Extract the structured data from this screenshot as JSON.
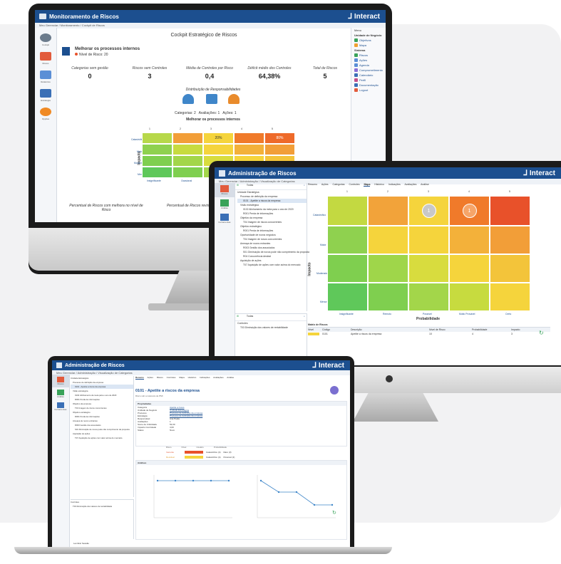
{
  "brand": "Interact",
  "colors": {
    "titlebar": "#1c4f8f",
    "heatmap_green": "#8fd14f",
    "heatmap_yellow": "#f5d43c",
    "heatmap_orange": "#f29e38",
    "heatmap_red": "#e8512a"
  },
  "cockpit": {
    "window_title": "Monitoramento de Riscos",
    "breadcrumb": "Meu Gerenciar  /  Monitoramento  /  Cockpit de Riscos",
    "page_title": "Cockpit Estratégico de Riscos",
    "objective_title": "Melhorar os processos internos",
    "risk_level": "Nível de Risco: 20",
    "sidebar": [
      "Cockpit",
      "Riscos",
      "Relatórios",
      "Estratégia",
      "Opções"
    ],
    "kpis": [
      {
        "label": "Categorias sem gestão",
        "value": "0"
      },
      {
        "label": "Riscos sem Controles",
        "value": "3"
      },
      {
        "label": "Média de Controles por Risco",
        "value": "0,4"
      },
      {
        "label": "Déficit médio dos Controles",
        "value": "64,38%"
      },
      {
        "label": "Total de Riscos",
        "value": "5"
      }
    ],
    "distribution_title": "Distribuição de Responsabilidades",
    "distribution_items": [
      "Categorias: 2",
      "Avaliações: 1",
      "Ações: 1"
    ],
    "matrix_title": "Melhorar os processos internos",
    "matrix_cols": [
      "1",
      "2",
      "3",
      "4",
      "5"
    ],
    "impact_axis": "Impacto",
    "impact_rows": [
      "Catastrófico",
      "Maior",
      "Moderado",
      "Menor"
    ],
    "prob_row": [
      "Insignificante",
      "Ocasional",
      "Possível",
      "Muito Provável",
      "Certo"
    ],
    "highlight_values": [
      "20%",
      "80%"
    ],
    "footer_left": "Percentual de Riscos com melhora no nível de Risco",
    "footer_mid": "Percentual de Riscos revisados",
    "right_panel": {
      "header": "Menu",
      "section1": "Unidade de Negócio",
      "items1": [
        "Objetivos",
        "Mapa"
      ],
      "section2": "Sistema",
      "items2": [
        "Riscos",
        "Ações",
        "Agenda",
        "Comprometimento",
        "Calendário",
        "Perfil",
        "Documentação",
        "Logout"
      ]
    }
  },
  "admin": {
    "window_title": "Administração de Riscos",
    "breadcrumb": "Meu Gerenciar  /  Administração  /  Visualização de Categorias",
    "sidebar": [
      "Riscos",
      "Análise",
      "Ferramentas"
    ],
    "search_placeholder": "Todas",
    "tree": [
      "Unidade Estratégica",
      "Processo de definição da empresa",
      "0101 - Apetite a riscos da empresa",
      "Visão estratégica",
      "0102 Alinhamento da meta para o ano de 2020",
      "R001 Perda de informações",
      "Objetivo da empresa",
      "T04 Imagem de riscos concorrentes",
      "Objetivo estratégico",
      "R001 Perda de informações",
      "Oportunidade de novos negócios",
      "T04 Imagem de novos concorrentes",
      "Ameaça de novos entrantes",
      "R003 Gestão dos associados",
      "S01 Diminuição de novos pode não cumprimento da proposta",
      "R04 Concorrência desleal",
      "Aquisição de ações",
      "T07 Aquisição de ações com valor acima do mercado"
    ],
    "tree2_root": "Controles",
    "tree2_item": "T03 Diminuição dos valores de rentabilidade",
    "tabs": [
      "Resumo",
      "Ações",
      "Categorias",
      "Controles",
      "Mapa",
      "Histórico",
      "Indicações",
      "Avaliações",
      "Análise"
    ],
    "active_tab": "Mapa",
    "matrix_cols": [
      "1",
      "2",
      "3",
      "4",
      "5"
    ],
    "impact_axis": "Impacto",
    "impact_rows": [
      "Catastrófico",
      "Maior",
      "Moderado",
      "Menor"
    ],
    "prob_labels": [
      "Insignificante",
      "Remoto",
      "Possível",
      "Muito Provável",
      "Certo"
    ],
    "prob_axis": "Probabilidade",
    "markers": [
      "1",
      "1"
    ],
    "table_title": "Matriz de Riscos",
    "table_headers": [
      "Nível",
      "Código",
      "Descrição",
      "Nível de Risco",
      "Probabilidade",
      "Impacto"
    ],
    "table_row": [
      "",
      "0101",
      "Apetite a riscos da empresa",
      "10",
      "4",
      "3"
    ]
  },
  "detail": {
    "window_title": "Administração de Riscos",
    "tabs": [
      "Resumo",
      "Ações",
      "Riscos",
      "Controles",
      "Mapa",
      "Histórico",
      "Indicações",
      "Avaliações",
      "Análise"
    ],
    "risk_title": "0101 - Apetite a riscos da empresa",
    "risk_subtitle": "Risco sob a natureza de PMI",
    "properties_title": "Propriedades",
    "properties": [
      [
        "Categoria",
        "Apetite a riscos"
      ],
      [
        "Unidade de Negócio",
        "Unidade Estratégica"
      ],
      [
        "Processo",
        "Processo de definição da empresa"
      ],
      [
        "Estratégia",
        "Processo de definição da empresa"
      ],
      [
        "Responsável",
        "Ana Paula"
      ],
      [
        "Avaliações",
        "1"
      ],
      [
        "Score de Criticidade",
        "52,00"
      ],
      [
        "Impacto Controlado",
        "4,00"
      ],
      [
        "Status",
        "Novo"
      ]
    ],
    "situation_headers": [
      "Risco",
      "Nível",
      "Usuário",
      "Probabilidade"
    ],
    "situations": [
      [
        "Inerente",
        "Catastrófico (4)",
        "Raro (3)"
      ],
      [
        "Residual",
        "Catastrófico (4)",
        "Possível (2)"
      ]
    ],
    "analysis_title": "Análises",
    "footer": "Lembrar Sessão"
  }
}
